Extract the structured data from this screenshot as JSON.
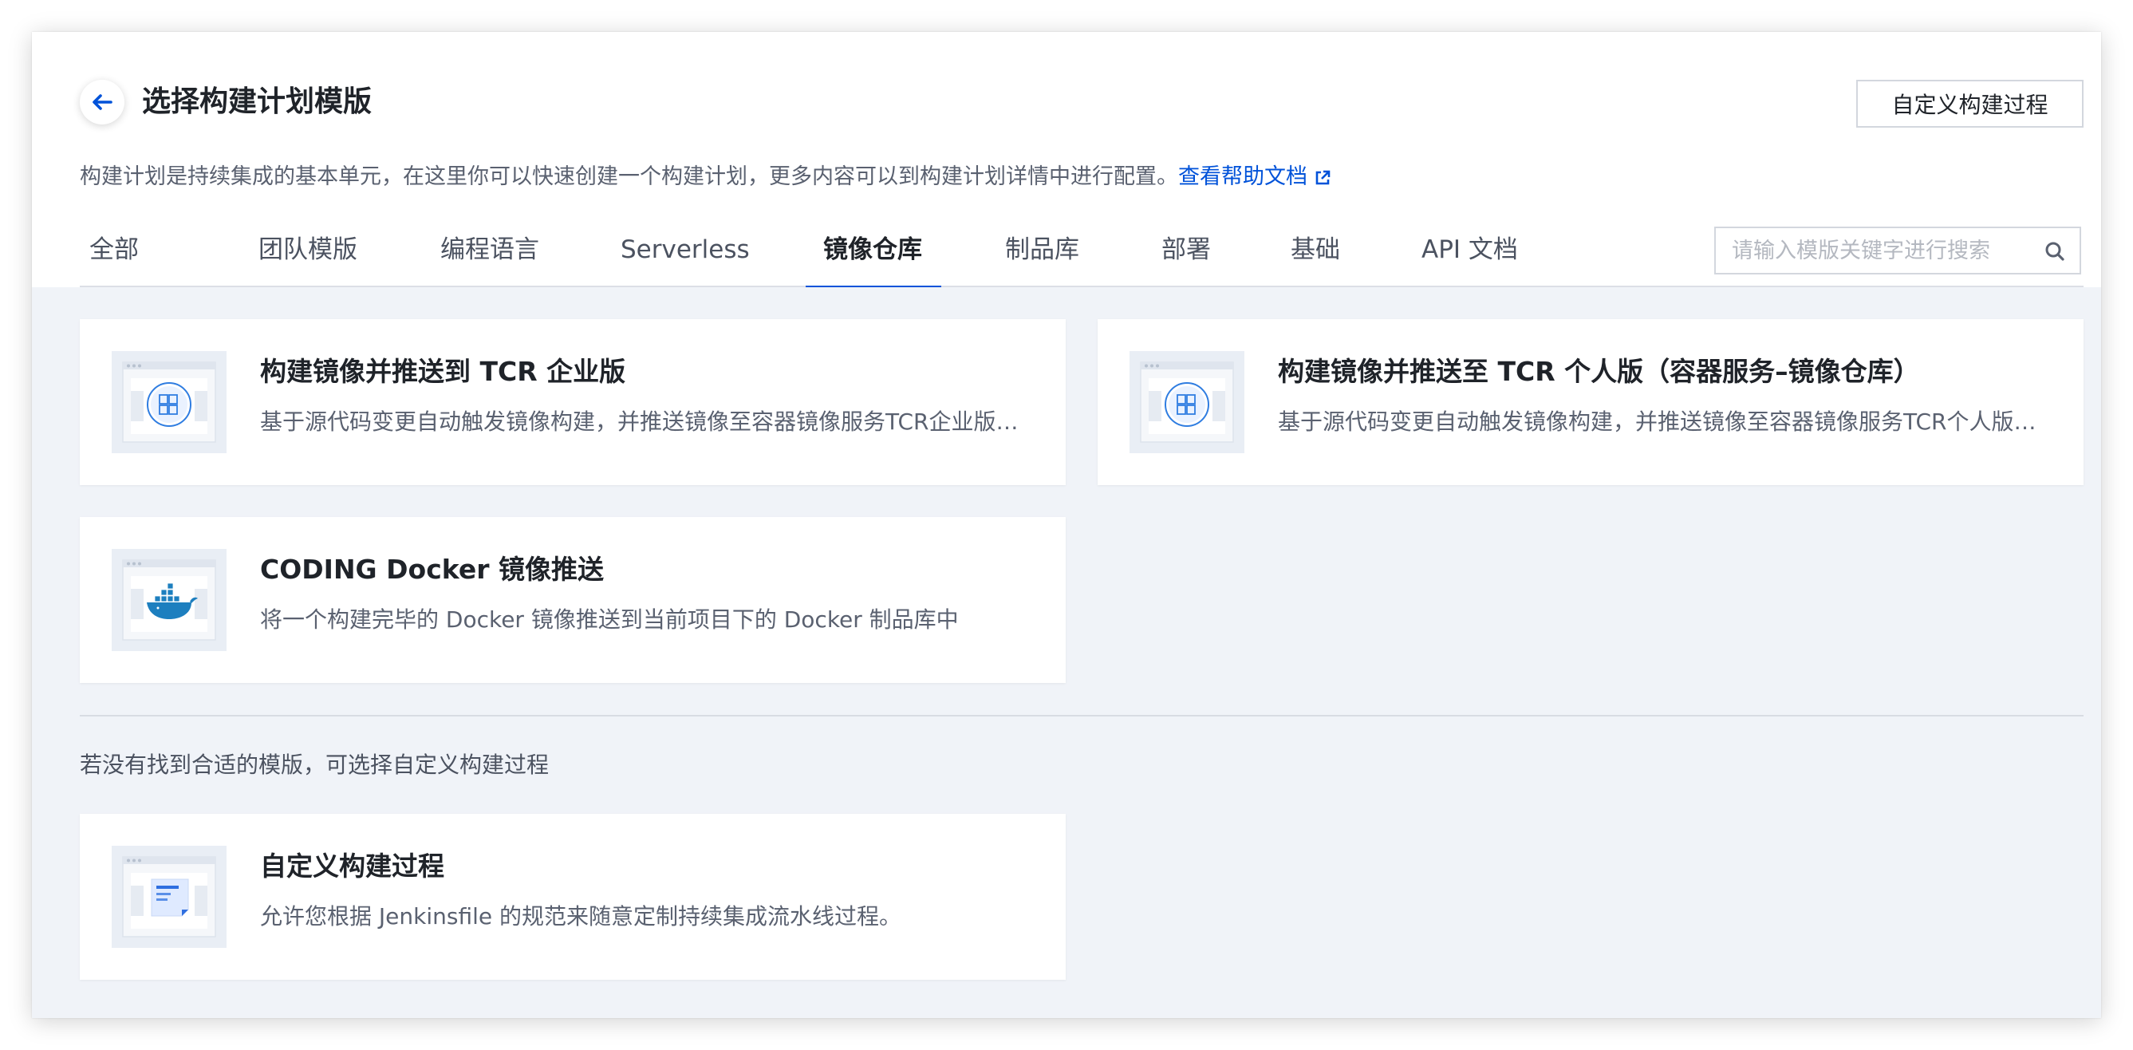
{
  "header": {
    "title": "选择构建计划模版",
    "custom_button": "自定义构建过程",
    "description": "构建计划是持续集成的基本单元，在这里你可以快速创建一个构建计划，更多内容可以到构建计划详情中进行配置。",
    "help_link": "查看帮助文档"
  },
  "tabs": [
    {
      "label": "全部"
    },
    {
      "label": "团队模版"
    },
    {
      "label": "编程语言"
    },
    {
      "label": "Serverless"
    },
    {
      "label": "镜像仓库",
      "active": true
    },
    {
      "label": "制品库"
    },
    {
      "label": "部署"
    },
    {
      "label": "基础"
    },
    {
      "label": "API 文档"
    }
  ],
  "search": {
    "placeholder": "请输入模版关键字进行搜索"
  },
  "cards": [
    {
      "title": "构建镜像并推送到 TCR 企业版",
      "desc": "基于源代码变更自动触发镜像构建，并推送镜像至容器镜像服务TCR企业版…",
      "icon": "container-registry-icon"
    },
    {
      "title": "构建镜像并推送至 TCR 个人版（容器服务–镜像仓库）",
      "desc": "基于源代码变更自动触发镜像构建，并推送镜像至容器镜像服务TCR个人版…",
      "icon": "container-registry-icon"
    },
    {
      "title": "CODING Docker 镜像推送",
      "desc": "将一个构建完毕的 Docker 镜像推送到当前项目下的 Docker 制品库中",
      "icon": "docker-whale-icon"
    }
  ],
  "hint": "若没有找到合适的模版，可选择自定义构建过程",
  "custom_card": {
    "title": "自定义构建过程",
    "desc": "允许您根据 Jenkinsfile 的规范来随意定制持续集成流水线过程。",
    "icon": "document-icon"
  },
  "colors": {
    "accent": "#0052d9",
    "background": "#f0f3f8",
    "text": "#1f2329",
    "secondary_text": "#5a6170"
  }
}
